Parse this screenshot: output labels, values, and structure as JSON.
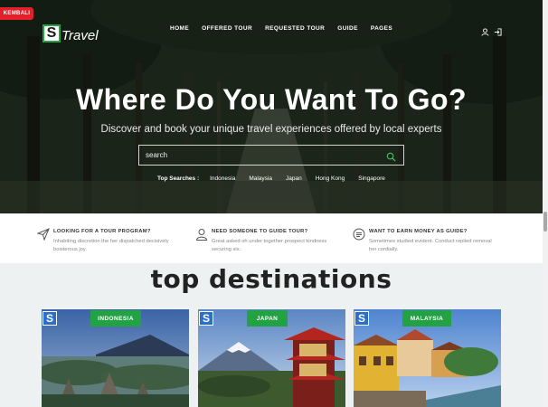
{
  "back_button": "KEMBALI",
  "logo": {
    "mark": "S",
    "word": "Travel"
  },
  "nav": {
    "items": [
      "HOME",
      "OFFERED TOUR",
      "REQUESTED TOUR",
      "GUIDE",
      "PAGES"
    ],
    "icons": [
      "user-icon",
      "sign-in-icon"
    ]
  },
  "hero": {
    "title": "Where Do You Want To Go?",
    "subtitle": "Discover and book your unique travel experiences offered by local experts"
  },
  "search": {
    "placeholder": "search",
    "value": ""
  },
  "top_searches": {
    "label": "Top Searches :",
    "tags": [
      "Indonesia",
      "Malaysia",
      "Japan",
      "Hong Kong",
      "Singapore"
    ]
  },
  "features": [
    {
      "icon": "paper-plane-icon",
      "title": "LOOKING FOR A TOUR PROGRAM?",
      "text": "Inhabiting discretion the her dispatched decisively boisterous joy."
    },
    {
      "icon": "user-icon",
      "title": "NEED SOMEONE TO GUIDE TOUR?",
      "text": "Great asked oh under together prospect kindness securing six."
    },
    {
      "icon": "list-icon",
      "title": "WANT TO EARN MONEY AS GUIDE?",
      "text": "Sometimes studied evident. Conduct replied removal her cordially."
    }
  ],
  "destinations": {
    "title": "top destinations",
    "cards": [
      {
        "badge": "S",
        "name": "INDONESIA"
      },
      {
        "badge": "S",
        "name": "JAPAN"
      },
      {
        "badge": "S",
        "name": "MALAYSIA"
      }
    ]
  },
  "colors": {
    "accent": "#23a244",
    "back": "#e1202a",
    "badge": "#2a6fcc"
  }
}
